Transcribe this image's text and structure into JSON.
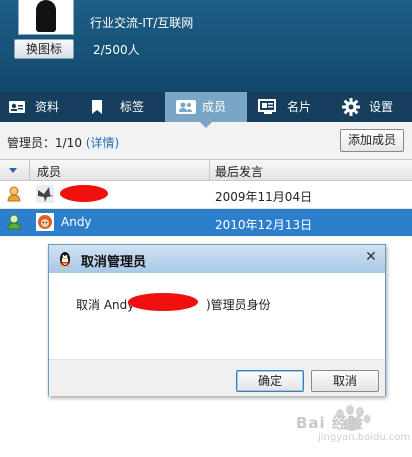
{
  "header": {
    "change_icon_label": "换图标",
    "group_category": "行业交流-IT/互联网",
    "member_count": "2/500人"
  },
  "tabs": [
    {
      "label": "资料",
      "icon": "profile-card-icon",
      "active": false
    },
    {
      "label": "标签",
      "icon": "bookmark-icon",
      "active": false
    },
    {
      "label": "成员",
      "icon": "members-icon",
      "active": true
    },
    {
      "label": "名片",
      "icon": "business-card-icon",
      "active": false
    },
    {
      "label": "设置",
      "icon": "gear-icon",
      "active": false
    }
  ],
  "admin": {
    "label": "管理员：1/10",
    "detail": "(详情)",
    "add_member_label": "添加成员"
  },
  "table": {
    "headers": {
      "member": "成员",
      "last_speech": "最后发言"
    },
    "rows": [
      {
        "name": "",
        "last_speech": "2009年11月04日",
        "role": "owner",
        "selected": false
      },
      {
        "name": "Andy",
        "last_speech": "2010年12月13日",
        "role": "admin",
        "selected": true
      }
    ]
  },
  "dialog": {
    "title": "取消管理员",
    "close_glyph": "✕",
    "message_pre": "取消 Andy",
    "message_post": ")管理员身份",
    "ok_label": "确定",
    "cancel_label": "取消"
  },
  "watermark": {
    "text": "Bai 经验",
    "sub": "jingyan.baidu.com"
  },
  "colors": {
    "header_bg": "#1a5780",
    "tab_bar": "#153f5d",
    "tab_active": "#7aa6c6",
    "selected_row": "#2d7fcb",
    "redaction": "#f01010",
    "link": "#2a6fb6"
  }
}
